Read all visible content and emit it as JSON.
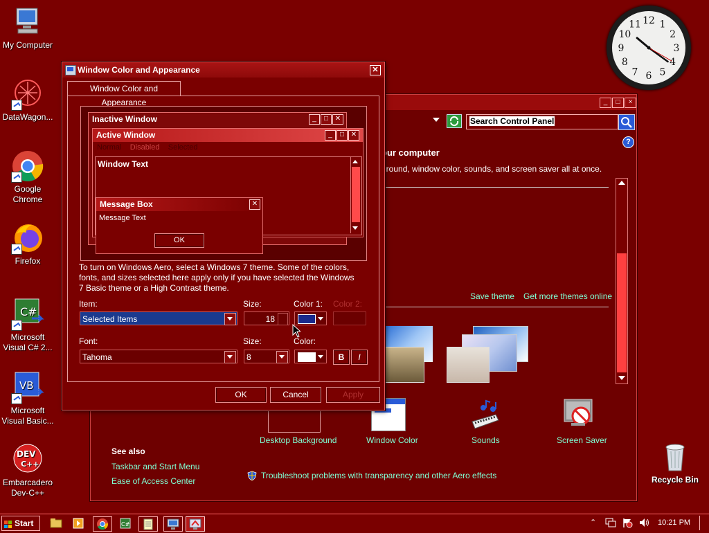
{
  "desktop": {
    "icons": [
      {
        "label": "My Computer"
      },
      {
        "label": "DataWagon..."
      },
      {
        "label": "Google Chrome"
      },
      {
        "label": "Firefox"
      },
      {
        "label": "Microsoft Visual C# 2..."
      },
      {
        "label": "Microsoft Visual Basic..."
      },
      {
        "label": "Embarcadero Dev-C++"
      },
      {
        "label": "Recycle Bin"
      }
    ]
  },
  "clock": {
    "numbers": [
      "12",
      "1",
      "2",
      "3",
      "4",
      "5",
      "6",
      "7",
      "8",
      "9",
      "10",
      "11"
    ]
  },
  "control_panel": {
    "search_placeholder": "Search Control Panel",
    "heading_partial": "our computer",
    "desc_partial": "ground, window color, sounds, and screen saver all at once.",
    "save_theme": "Save theme",
    "get_more_themes": "Get more themes online",
    "bottom_items": [
      {
        "label": "Desktop Background"
      },
      {
        "label": "Window Color"
      },
      {
        "label": "Sounds"
      },
      {
        "label": "Screen Saver"
      }
    ],
    "see_also": {
      "title": "See also",
      "links": [
        "Taskbar and Start Menu",
        "Ease of Access Center"
      ]
    },
    "troubleshoot": "Troubleshoot problems with transparency and other Aero effects"
  },
  "dialog": {
    "title": "Window Color and Appearance",
    "tab": "Window Color and Appearance",
    "preview": {
      "inactive": "Inactive Window",
      "active": "Active Window",
      "menu": [
        "Normal",
        "Disabled",
        "Selected"
      ],
      "window_text": "Window Text",
      "message_box": "Message Box",
      "message_text": "Message Text",
      "ok": "OK"
    },
    "info": "To turn on Windows Aero, select a Windows 7 theme.  Some of the colors, fonts, and sizes selected here apply only if you have selected the Windows 7 Basic theme or a High Contrast theme.",
    "item_label": "Item:",
    "item_value": "Selected Items",
    "size_label": "Size:",
    "size_value": "18",
    "color1_label": "Color 1:",
    "color2_label": "Color 2:",
    "font_label": "Font:",
    "font_value": "Tahoma",
    "size2_label": "Size:",
    "size2_value": "8",
    "color_label": "Color:",
    "bold": "B",
    "italic": "I",
    "ok": "OK",
    "cancel": "Cancel",
    "apply": "Apply",
    "color1_hex": "#1a2a8c",
    "color_hex": "#ffffff"
  },
  "taskbar": {
    "start": "Start",
    "time": "10:21 PM"
  },
  "colors": {
    "desktop_bg": "#7a0000",
    "link": "#7fffd4",
    "selected_item": "#1a3a8f"
  }
}
